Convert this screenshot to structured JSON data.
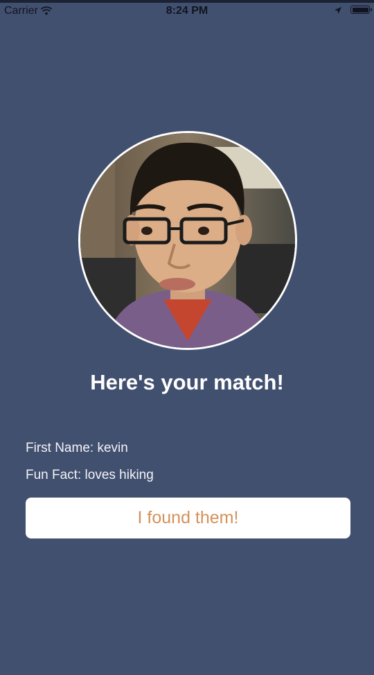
{
  "status_bar": {
    "carrier": "Carrier",
    "time": "8:24 PM",
    "icons": [
      "wifi-icon",
      "location-icon",
      "battery-icon"
    ]
  },
  "match": {
    "photo_icon": "profile-photo",
    "title": "Here's your match!",
    "first_name": "First Name: kevin",
    "fun_fact": "Fun Fact: loves hiking",
    "button_label": "I found them!"
  },
  "colors": {
    "background": "#42506f",
    "button_text": "#d4915a",
    "button_bg": "#ffffff"
  }
}
